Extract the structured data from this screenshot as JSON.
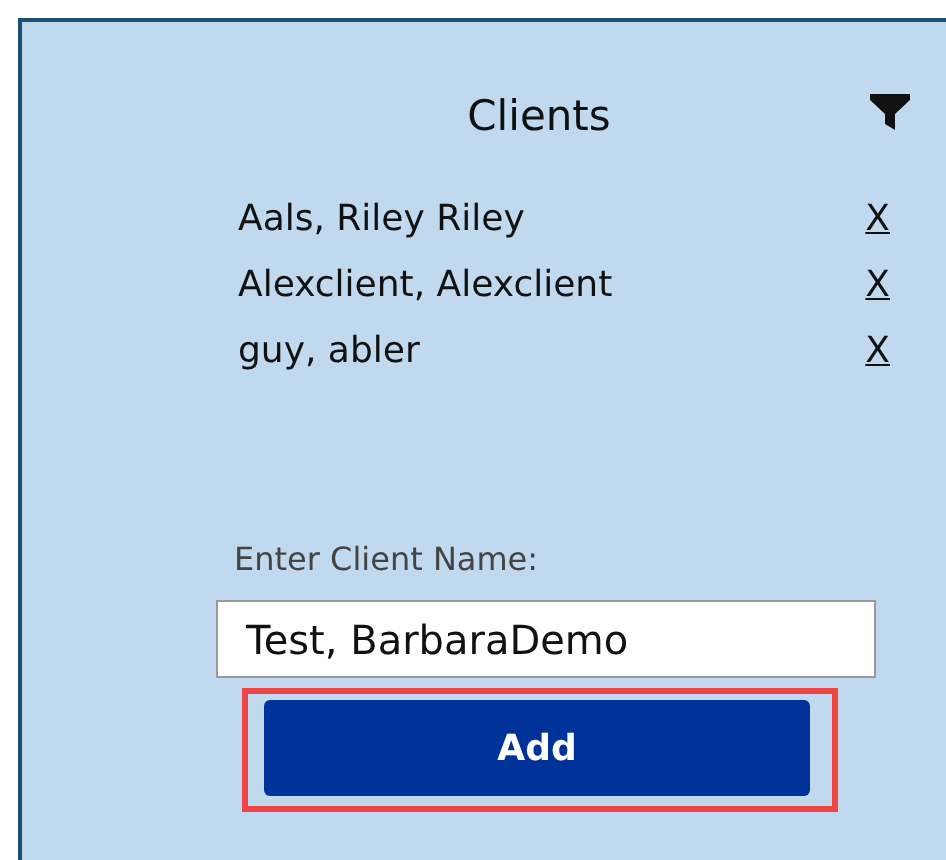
{
  "panel": {
    "title": "Clients",
    "clients": [
      {
        "name": "Aals, Riley Riley",
        "remove": "X"
      },
      {
        "name": "Alexclient, Alexclient",
        "remove": "X"
      },
      {
        "name": "guy, abler",
        "remove": "X"
      }
    ],
    "form": {
      "label": "Enter Client Name:",
      "value": "Test, BarbaraDemo",
      "button": "Add",
      "button_highlighted": true
    }
  }
}
